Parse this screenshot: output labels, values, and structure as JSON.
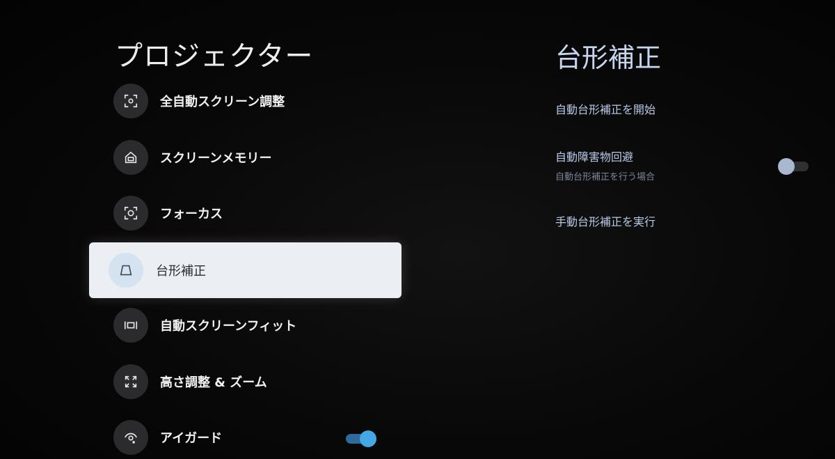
{
  "left_panel": {
    "title": "プロジェクター",
    "items": [
      {
        "label": "全自動スクリーン調整",
        "icon": "auto-screen-adjust-icon"
      },
      {
        "label": "スクリーンメモリー",
        "icon": "screen-memory-icon"
      },
      {
        "label": "フォーカス",
        "icon": "focus-icon"
      },
      {
        "label": "台形補正",
        "icon": "keystone-icon",
        "selected": true
      },
      {
        "label": "自動スクリーンフィット",
        "icon": "screen-fit-icon"
      },
      {
        "label": "高さ調整 & ズーム",
        "icon": "zoom-icon"
      },
      {
        "label": "アイガード",
        "icon": "eye-guard-icon",
        "toggle": "on"
      }
    ]
  },
  "right_panel": {
    "title": "台形補正",
    "options": [
      {
        "label": "自動台形補正を開始"
      },
      {
        "label": "自動障害物回避",
        "sublabel": "自動台形補正を行う場合",
        "toggle": "off"
      },
      {
        "label": "手動台形補正を実行"
      }
    ]
  },
  "colors": {
    "background": "#050505",
    "selected_bg": "#ebeef2",
    "toggle_on": "#45a8e6",
    "toggle_off_knob": "#a7b8cf",
    "right_text": "#b9c9e6"
  }
}
